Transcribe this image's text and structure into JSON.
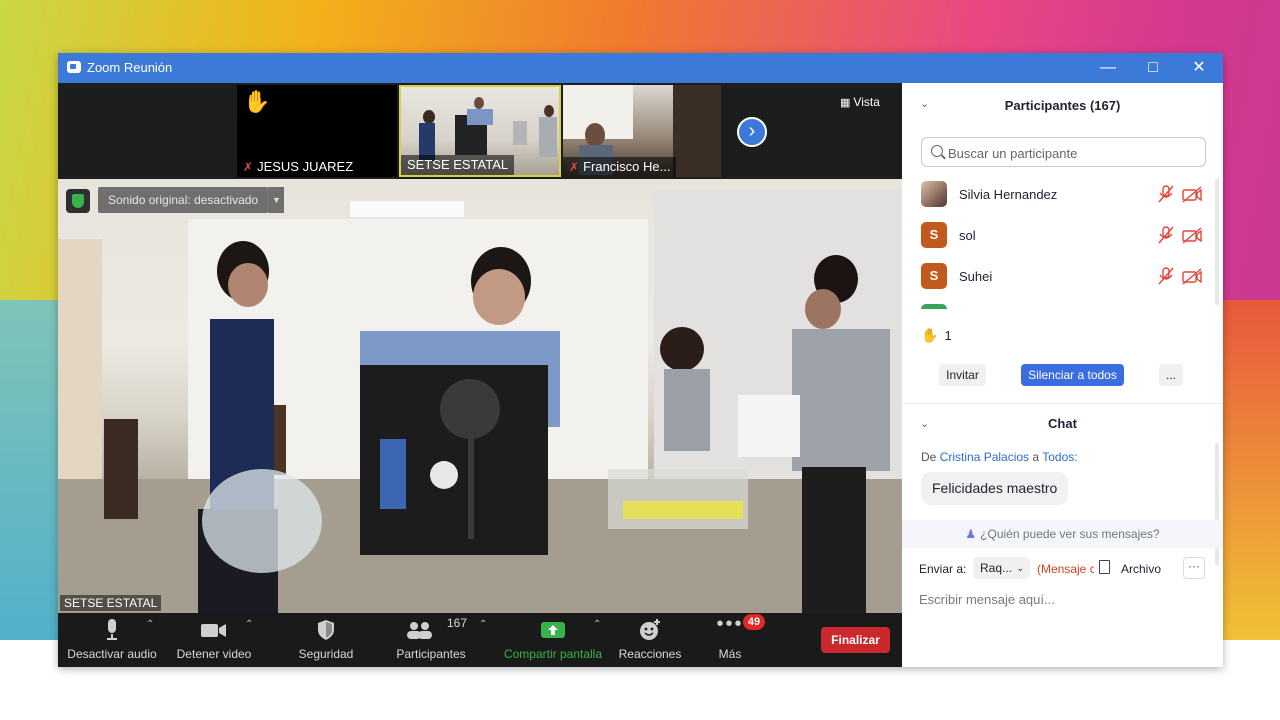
{
  "window": {
    "title": "Zoom Reunión",
    "minimize_icon": "minimize-icon",
    "maximize_icon": "maximize-icon",
    "close_icon": "close-icon",
    "titlebar_color": "#3b7ad9"
  },
  "video_strip": {
    "thumbnails": [
      {
        "name": "JESUS JUAREZ",
        "muted": true,
        "hand_raised": true
      },
      {
        "name": "SETSE ESTATAL",
        "muted": false,
        "active": true
      },
      {
        "name": "Francisco He...",
        "muted": true
      }
    ],
    "next_icon": "chevron-right-icon",
    "view_label": "Vista"
  },
  "main_video": {
    "sound_setting": "Sonido original: desactivado",
    "speaker_label": "SETSE ESTATAL",
    "encryption_icon": "shield-check-icon"
  },
  "toolbar": {
    "audio_label": "Desactivar audio",
    "video_label": "Detener video",
    "security_label": "Seguridad",
    "participants_label": "Participantes",
    "participants_count": "167",
    "share_label": "Compartir pantalla",
    "reactions_label": "Reacciones",
    "more_label": "Más",
    "more_badge": "49",
    "end_label": "Finalizar",
    "share_color": "#37b34a",
    "end_color": "#c9282d"
  },
  "participants_panel": {
    "title": "Participantes (167)",
    "search_placeholder": "Buscar un participante",
    "participants": [
      {
        "name": "Silvia Hernandez",
        "avatar": "photo",
        "avatar_color": "#b89b86",
        "muted": true,
        "video_off": true
      },
      {
        "name": "sol",
        "avatar": "S",
        "avatar_color": "#c35a1d",
        "muted": true,
        "video_off": true
      },
      {
        "name": "Suhei",
        "avatar": "S",
        "avatar_color": "#c35a1d",
        "muted": true,
        "video_off": true
      }
    ],
    "raised_hands": "1",
    "invite_label": "Invitar",
    "mute_all_label": "Silenciar a todos",
    "more_label": "...",
    "accent_color": "#3b6de0"
  },
  "chat": {
    "title": "Chat",
    "message": {
      "from_prefix": "De",
      "sender": "Cristina Palacios",
      "to_prefix": "a",
      "recipient": "Todos:",
      "text": "Felicidades maestro"
    },
    "who_can_see": "¿Quién puede ver sus mensajes?",
    "send_to_label": "Enviar a:",
    "send_to_value": "Raq...",
    "private_note": "(Mensaje c",
    "file_label": "Archivo",
    "more_label": "···",
    "input_placeholder": "Escribir mensaje aquí..."
  }
}
